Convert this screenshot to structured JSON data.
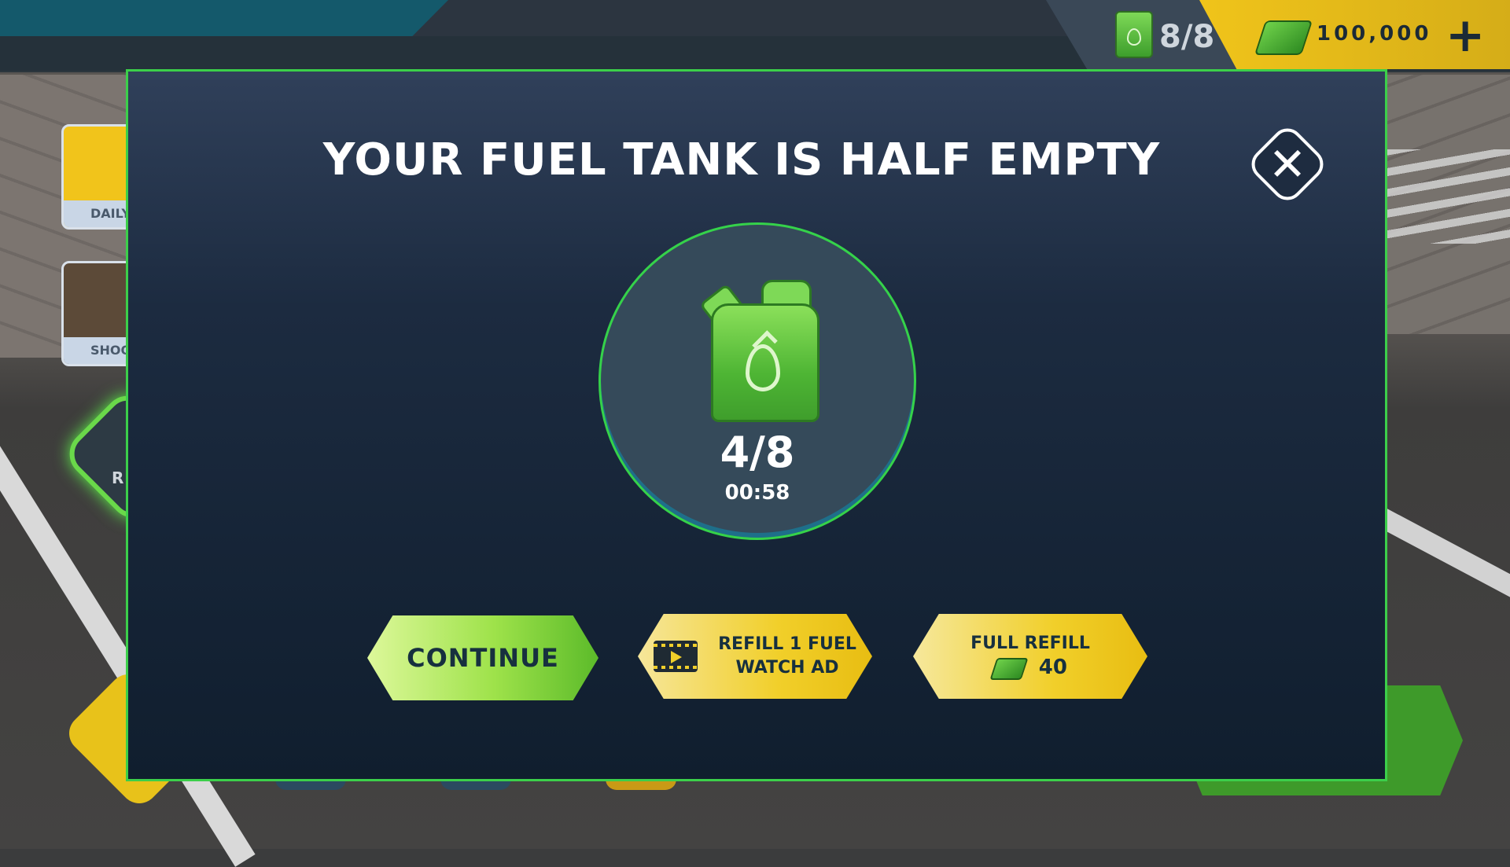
{
  "hud": {
    "fuel": "8/8",
    "cash": "100,000",
    "add_symbol": "+"
  },
  "side_menu": {
    "daily_label": "DAILY",
    "shoot_label": "SHOO",
    "round_label": "R"
  },
  "modal": {
    "title": "YOUR FUEL TANK IS HALF EMPTY",
    "close_symbol": "✕",
    "fuel_count": "4/8",
    "timer": "00:58",
    "continue_label": "CONTINUE",
    "refill_ad_line1": "REFILL 1 FUEL",
    "refill_ad_line2": "WATCH AD",
    "full_refill_label": "FULL REFILL",
    "full_refill_cost": "40"
  },
  "colors": {
    "accent_green": "#3ccf4a",
    "button_yellow": "#f1cf2a",
    "modal_bg": "#1c2b40"
  }
}
